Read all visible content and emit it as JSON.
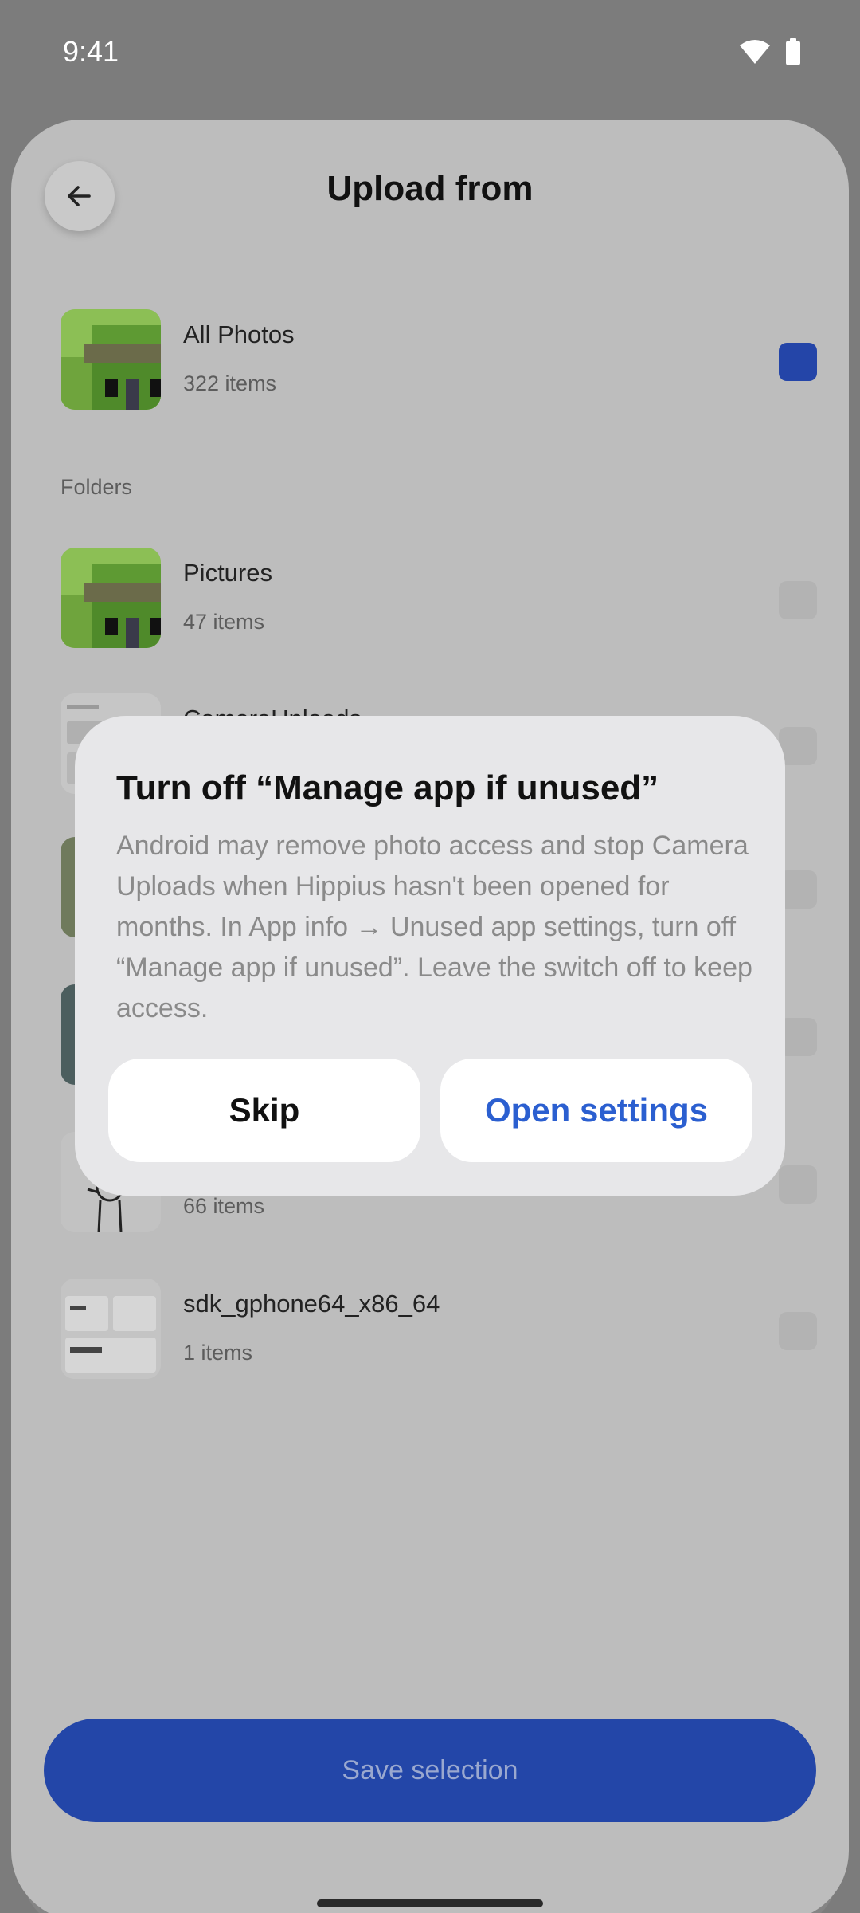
{
  "status_bar": {
    "time": "9:41",
    "icons": [
      "wifi-icon",
      "battery-icon"
    ]
  },
  "header": {
    "title": "Upload from",
    "back_icon": "arrow-left-icon"
  },
  "all_photos": {
    "title": "All Photos",
    "count": "322 items",
    "selected": true
  },
  "folders": {
    "label": "Folders",
    "items": [
      {
        "title": "Pictures",
        "count": "47 items",
        "selected": false
      },
      {
        "title": "CameraUploads",
        "count": "",
        "selected": false
      },
      {
        "title": "",
        "count": "",
        "selected": false
      },
      {
        "title": "",
        "count": "",
        "selected": false
      },
      {
        "title": "",
        "count": "66 items",
        "selected": false
      },
      {
        "title": "sdk_gphone64_x86_64",
        "count": "1 items",
        "selected": false
      }
    ]
  },
  "footer": {
    "save_label": "Save selection"
  },
  "dialog": {
    "title": "Turn off “Manage app if unused”",
    "body": "Android may remove photo access and stop Camera Uploads when Hippius hasn't been opened for months. In App info → Unused app settings, turn off “Manage app if unused”. Leave the switch off to keep access.",
    "skip_label": "Skip",
    "open_label": "Open settings"
  },
  "colors": {
    "accent": "#2346a8",
    "dialog_link": "#2b5fd0",
    "scrim": "#7c7c7c",
    "dialog_bg": "#e7e7e9"
  }
}
